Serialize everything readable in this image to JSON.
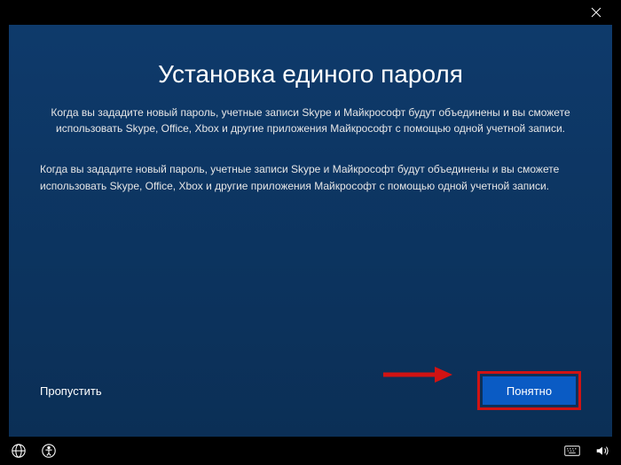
{
  "titlebar": {
    "close_label": "Close"
  },
  "content": {
    "heading": "Установка единого пароля",
    "subheading": "Когда вы зададите новый пароль, учетные записи Skype и Майкрософт будут объединены и вы сможете использовать Skype, Office, Xbox и другие приложения Майкрософт с помощью одной учетной записи.",
    "body": "Когда вы зададите новый пароль, учетные записи Skype и Майкрософт будут объединены и вы сможете использовать Skype, Office, Xbox и другие приложения Майкрософт с помощью одной учетной записи."
  },
  "actions": {
    "skip_label": "Пропустить",
    "primary_label": "Понятно"
  },
  "taskbar": {
    "globe": "Language",
    "accessibility": "Ease of access",
    "keyboard": "Keyboard",
    "volume": "Volume"
  },
  "colors": {
    "panel_top": "#0e3a6b",
    "panel_bottom": "#0b2f56",
    "primary_button": "#0a5bc4",
    "highlight_box": "#d11313"
  }
}
